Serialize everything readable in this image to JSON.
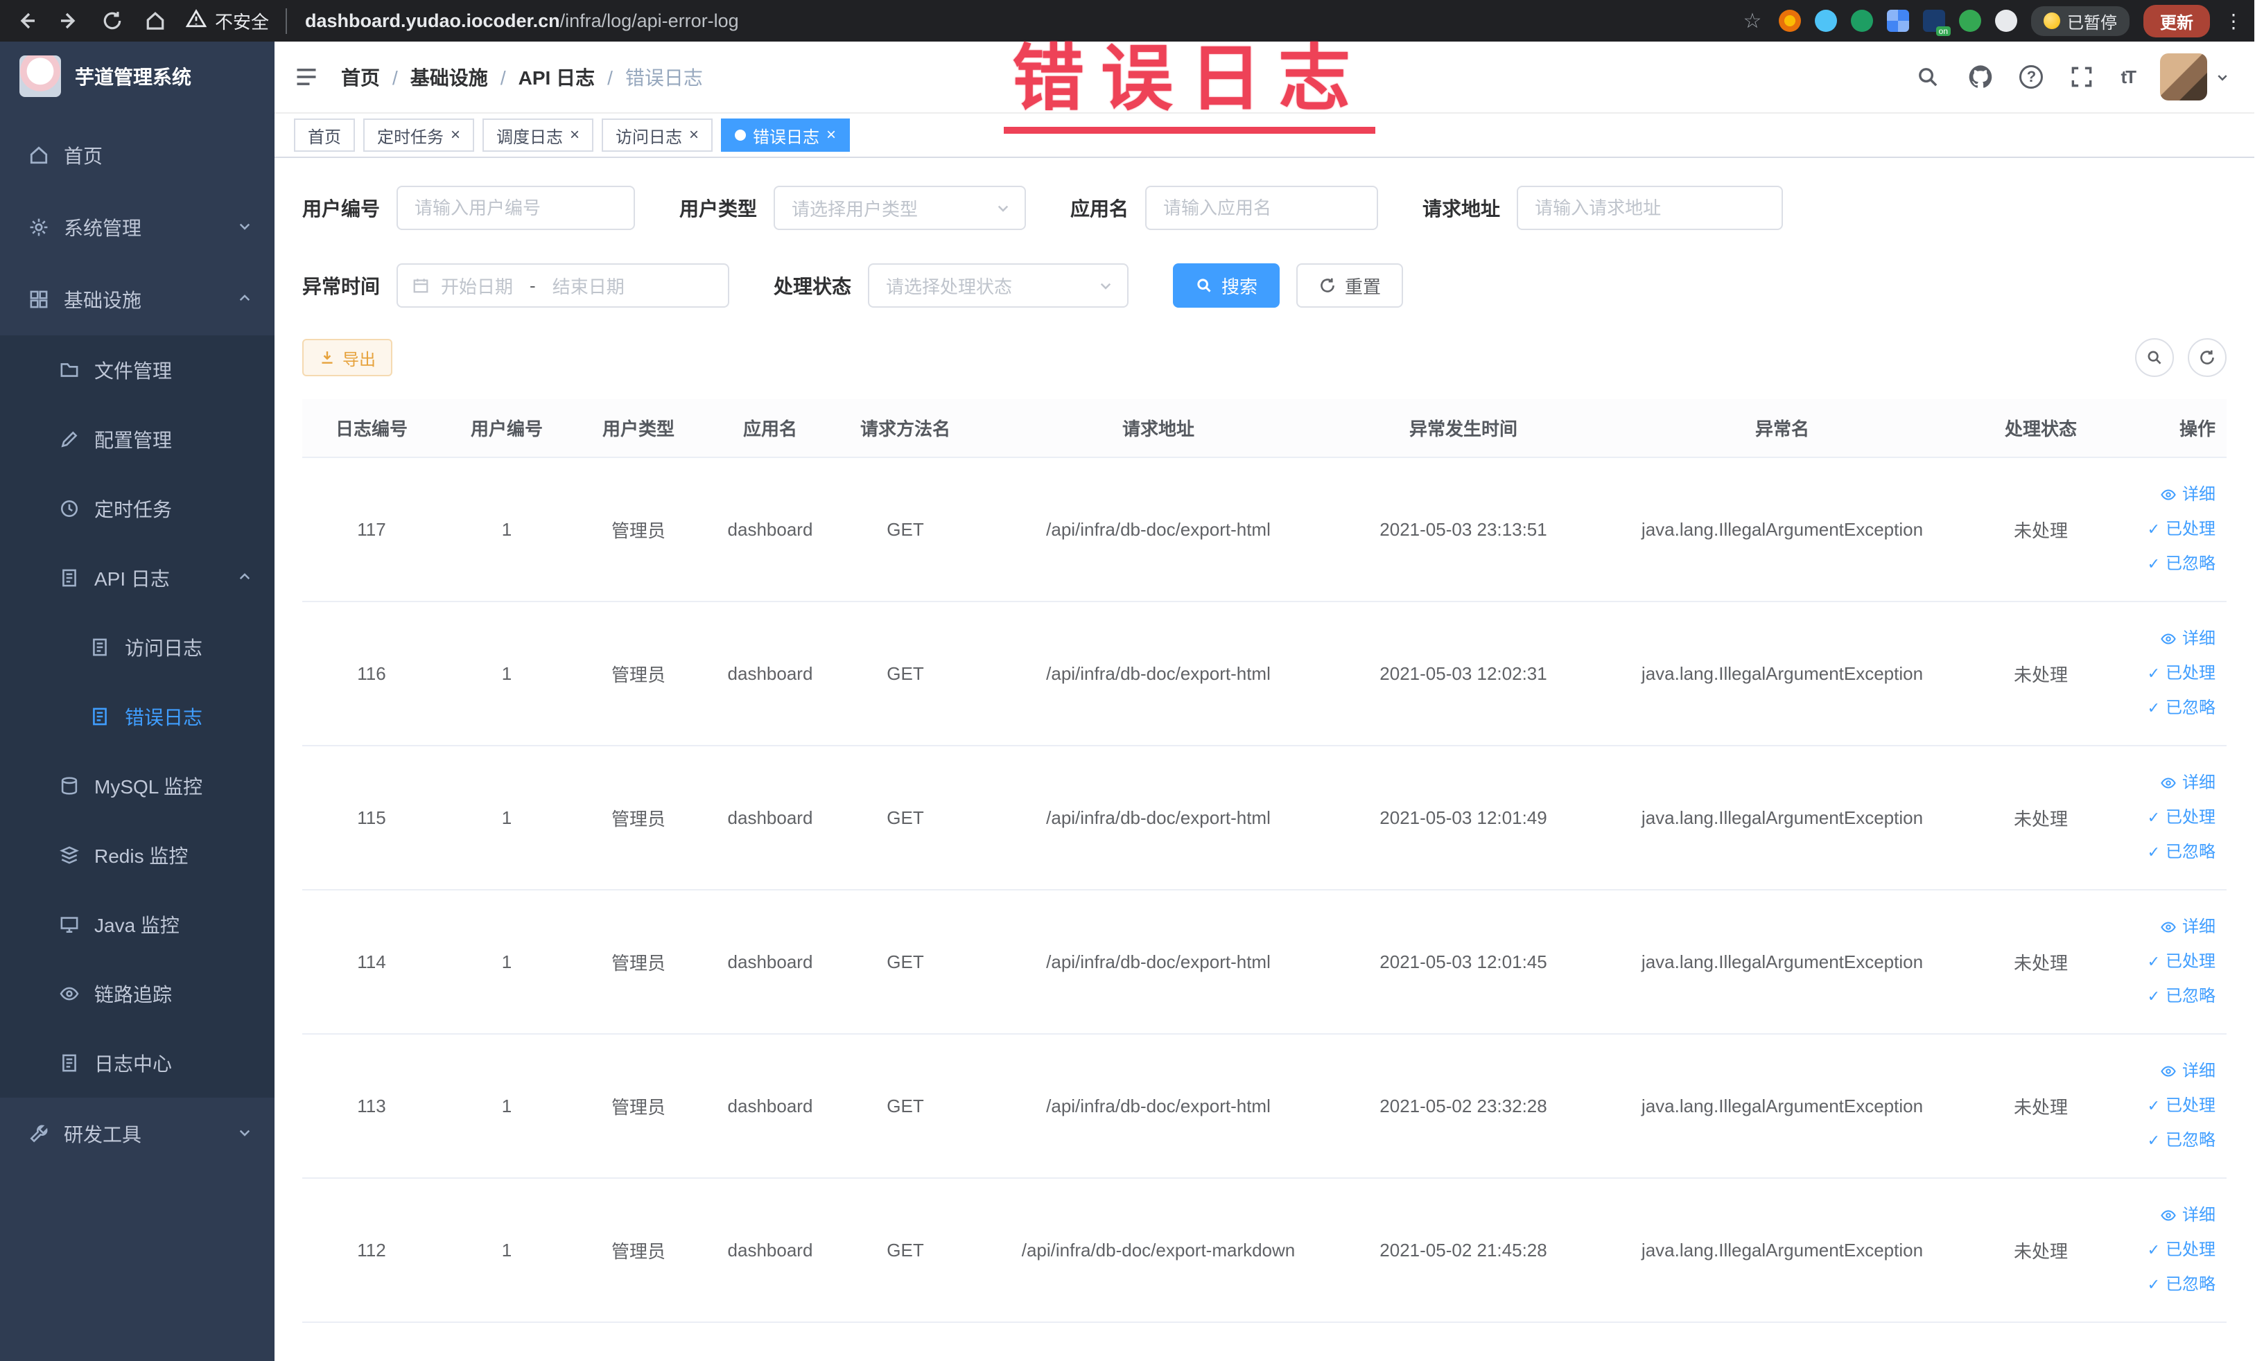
{
  "overlay": {
    "text": "错误日志"
  },
  "colors": {
    "accent": "#409eff",
    "warning": "#e6a23c",
    "annotation": "#ee4257",
    "sidebar_bg": "#2f3c52",
    "submenu_bg": "#273447"
  },
  "icons": {
    "help": "?",
    "font_size": "tT",
    "close": "×",
    "overflow": "⋮",
    "star": "☆",
    "check": "✓"
  },
  "browser": {
    "security_label": "不安全",
    "url_domain": "dashboard.yudao.iocoder.cn",
    "url_path": "/infra/log/api-error-log",
    "paused_label": "已暂停",
    "update_label": "更新"
  },
  "sidebar": {
    "app_title": "芋道管理系统",
    "items": [
      {
        "label": "首页"
      },
      {
        "label": "系统管理"
      },
      {
        "label": "基础设施"
      },
      {
        "label": "文件管理"
      },
      {
        "label": "配置管理"
      },
      {
        "label": "定时任务"
      },
      {
        "label": "API 日志"
      },
      {
        "label": "访问日志"
      },
      {
        "label": "错误日志"
      },
      {
        "label": "MySQL 监控"
      },
      {
        "label": "Redis 监控"
      },
      {
        "label": "Java 监控"
      },
      {
        "label": "链路追踪"
      },
      {
        "label": "日志中心"
      },
      {
        "label": "研发工具"
      }
    ]
  },
  "header": {
    "breadcrumb": [
      "首页",
      "基础设施",
      "API 日志",
      "错误日志"
    ]
  },
  "tabs": [
    {
      "label": "首页"
    },
    {
      "label": "定时任务"
    },
    {
      "label": "调度日志"
    },
    {
      "label": "访问日志"
    },
    {
      "label": "错误日志"
    }
  ],
  "filters": {
    "user_id_label": "用户编号",
    "user_id_placeholder": "请输入用户编号",
    "user_type_label": "用户类型",
    "user_type_placeholder": "请选择用户类型",
    "app_name_label": "应用名",
    "app_name_placeholder": "请输入应用名",
    "request_url_label": "请求地址",
    "request_url_placeholder": "请输入请求地址",
    "exception_time_label": "异常时间",
    "start_date_placeholder": "开始日期",
    "end_date_placeholder": "结束日期",
    "range_separator": "-",
    "process_status_label": "处理状态",
    "process_status_placeholder": "请选择处理状态",
    "search_label": "搜索",
    "reset_label": "重置"
  },
  "toolbar": {
    "export_label": "导出"
  },
  "table": {
    "headers": [
      "日志编号",
      "用户编号",
      "用户类型",
      "应用名",
      "请求方法名",
      "请求地址",
      "异常发生时间",
      "异常名",
      "处理状态",
      "操作"
    ],
    "actions": {
      "detail": "详细",
      "processed": "已处理",
      "ignored": "已忽略"
    },
    "rows": [
      {
        "log_id": "117",
        "user_id": "1",
        "user_type": "管理员",
        "app_name": "dashboard",
        "method": "GET",
        "url": "/api/infra/db-doc/export-html",
        "time": "2021-05-03 23:13:51",
        "exception": "java.lang.IllegalArgumentException",
        "status": "未处理"
      },
      {
        "log_id": "116",
        "user_id": "1",
        "user_type": "管理员",
        "app_name": "dashboard",
        "method": "GET",
        "url": "/api/infra/db-doc/export-html",
        "time": "2021-05-03 12:02:31",
        "exception": "java.lang.IllegalArgumentException",
        "status": "未处理"
      },
      {
        "log_id": "115",
        "user_id": "1",
        "user_type": "管理员",
        "app_name": "dashboard",
        "method": "GET",
        "url": "/api/infra/db-doc/export-html",
        "time": "2021-05-03 12:01:49",
        "exception": "java.lang.IllegalArgumentException",
        "status": "未处理"
      },
      {
        "log_id": "114",
        "user_id": "1",
        "user_type": "管理员",
        "app_name": "dashboard",
        "method": "GET",
        "url": "/api/infra/db-doc/export-html",
        "time": "2021-05-03 12:01:45",
        "exception": "java.lang.IllegalArgumentException",
        "status": "未处理"
      },
      {
        "log_id": "113",
        "user_id": "1",
        "user_type": "管理员",
        "app_name": "dashboard",
        "method": "GET",
        "url": "/api/infra/db-doc/export-html",
        "time": "2021-05-02 23:32:28",
        "exception": "java.lang.IllegalArgumentException",
        "status": "未处理"
      },
      {
        "log_id": "112",
        "user_id": "1",
        "user_type": "管理员",
        "app_name": "dashboard",
        "method": "GET",
        "url": "/api/infra/db-doc/export-markdown",
        "time": "2021-05-02 21:45:28",
        "exception": "java.lang.IllegalArgumentException",
        "status": "未处理"
      }
    ]
  }
}
